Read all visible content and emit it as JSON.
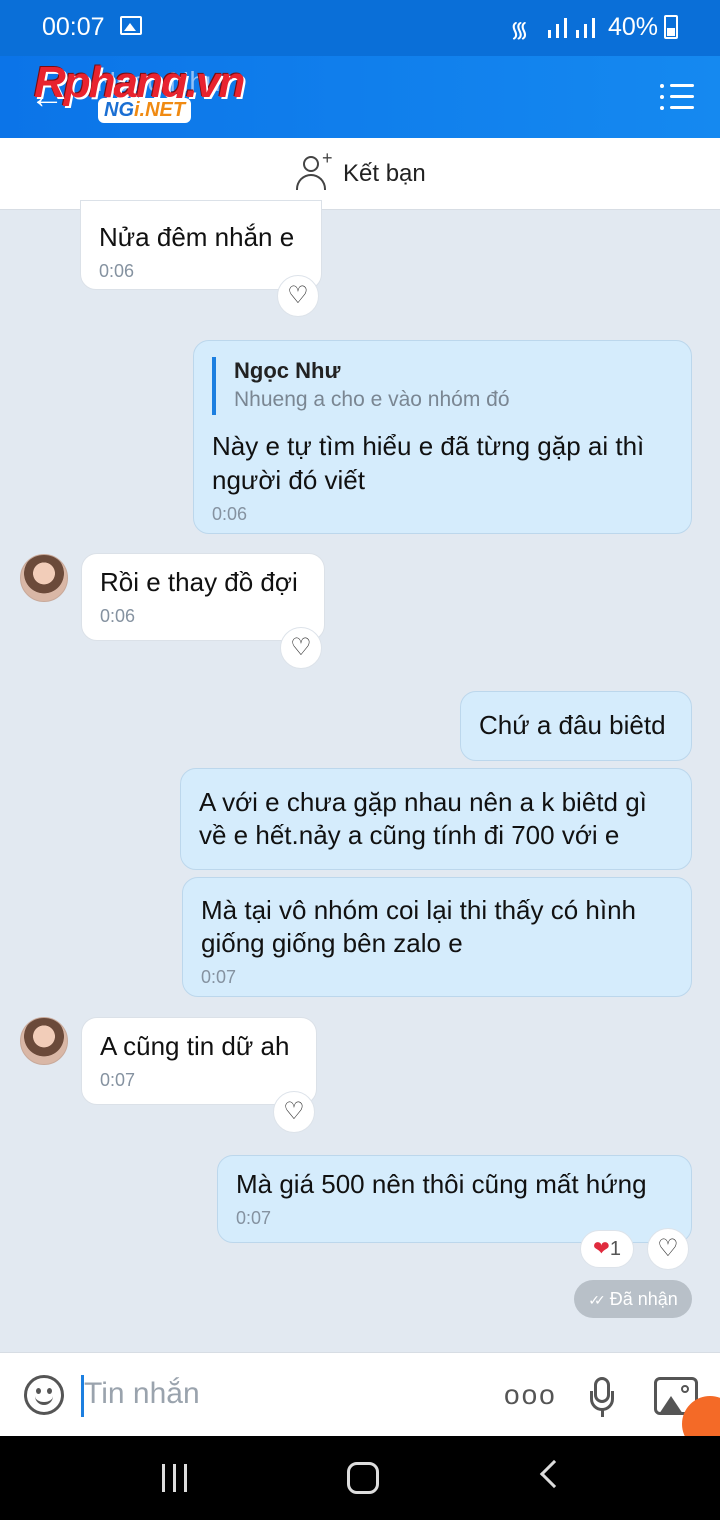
{
  "status_bar": {
    "time": "00:07",
    "battery": "40%"
  },
  "header": {
    "title": "Ngọc Như",
    "watermark_main": "Rphang.vn",
    "watermark_badge_a": "NG",
    "watermark_badge_b": "i.NET"
  },
  "add_friend": {
    "label": "Kết bạn"
  },
  "messages": [
    {
      "side": "in",
      "text": "Nửa đêm nhắn e",
      "time": "0:06"
    },
    {
      "side": "out",
      "quote_name": "Ngọc Như",
      "quote_text": "Nhueng a cho e vào nhóm đó",
      "text": "Này e tự tìm hiểu e đã từng gặp ai thì người đó viết",
      "time": "0:06"
    },
    {
      "side": "in",
      "text": "Rồi e thay đồ đợi",
      "time": "0:06"
    },
    {
      "side": "out",
      "text": "Chứ a đâu biêtd"
    },
    {
      "side": "out",
      "text": "A với e chưa gặp nhau nên a k biêtd gì về e hết.nảy a cũng tính đi 700 với e"
    },
    {
      "side": "out",
      "text": "Mà tại vô nhóm coi lại thi thấy có hình giống giống bên zalo e",
      "time": "0:07"
    },
    {
      "side": "in",
      "text": "A cũng tin dữ ah",
      "time": "0:07"
    },
    {
      "side": "out",
      "text": "Mà giá 500 nên thôi cũng mất hứng",
      "time": "0:07",
      "reaction_count": "1"
    }
  ],
  "seen_label": "Đã nhận",
  "input": {
    "placeholder": "Tin nhắn"
  },
  "icons": {
    "heart": "♡",
    "heart_filled": "❤",
    "back": "←",
    "dots": "ooo",
    "check": "✓✓"
  },
  "colors": {
    "header": "#0b74e8",
    "out_bubble": "#d5ecfc",
    "in_bubble": "#ffffff",
    "background": "#e2e9f1"
  }
}
